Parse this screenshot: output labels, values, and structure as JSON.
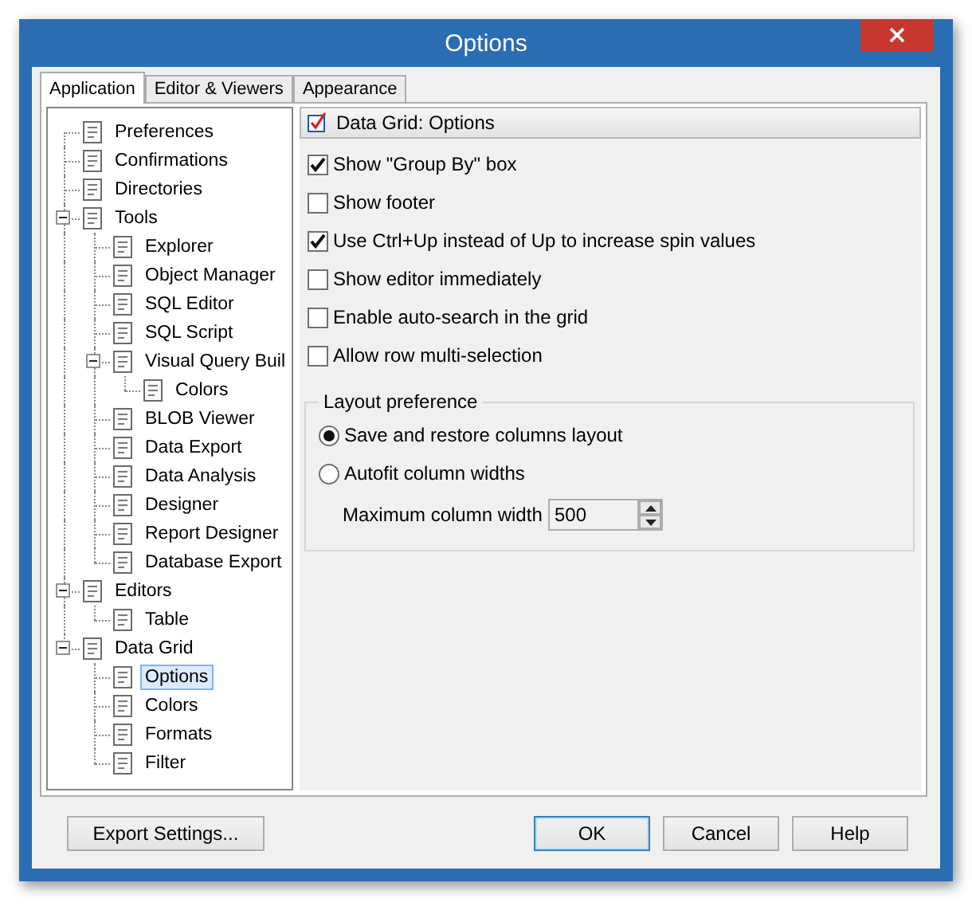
{
  "window": {
    "title": "Options"
  },
  "tabs": [
    {
      "label": "Application",
      "selected": true
    },
    {
      "label": "Editor & Viewers",
      "selected": false
    },
    {
      "label": "Appearance",
      "selected": false
    }
  ],
  "tree": [
    {
      "label": "Preferences",
      "selected": false
    },
    {
      "label": "Confirmations",
      "selected": false
    },
    {
      "label": "Directories",
      "selected": false
    },
    {
      "label": "Tools",
      "selected": false,
      "expanded": true,
      "children": [
        {
          "label": "Explorer",
          "selected": false
        },
        {
          "label": "Object Manager",
          "selected": false
        },
        {
          "label": "SQL Editor",
          "selected": false
        },
        {
          "label": "SQL Script",
          "selected": false
        },
        {
          "label": "Visual Query Buil",
          "selected": false,
          "expanded": true,
          "children": [
            {
              "label": "Colors",
              "selected": false
            }
          ]
        },
        {
          "label": "BLOB Viewer",
          "selected": false
        },
        {
          "label": "Data Export",
          "selected": false
        },
        {
          "label": "Data Analysis",
          "selected": false
        },
        {
          "label": "Designer",
          "selected": false
        },
        {
          "label": "Report Designer",
          "selected": false
        },
        {
          "label": "Database Export",
          "selected": false
        }
      ]
    },
    {
      "label": "Editors",
      "selected": false,
      "expanded": true,
      "children": [
        {
          "label": "Table",
          "selected": false
        }
      ]
    },
    {
      "label": "Data Grid",
      "selected": false,
      "expanded": true,
      "children": [
        {
          "label": "Options",
          "selected": true
        },
        {
          "label": "Colors",
          "selected": false
        },
        {
          "label": "Formats",
          "selected": false
        },
        {
          "label": "Filter",
          "selected": false
        }
      ]
    }
  ],
  "section_title": "Data Grid: Options",
  "options": [
    {
      "label": "Show \"Group By\" box",
      "checked": true
    },
    {
      "label": "Show footer",
      "checked": false
    },
    {
      "label": "Use Ctrl+Up instead of Up to increase spin values",
      "checked": true
    },
    {
      "label": "Show editor immediately",
      "checked": false
    },
    {
      "label": "Enable auto-search in the grid",
      "checked": false
    },
    {
      "label": "Allow row multi-selection",
      "checked": false
    }
  ],
  "layout_group": {
    "title": "Layout preference",
    "choices": [
      {
        "label": "Save and restore columns layout",
        "selected": true
      },
      {
        "label": "Autofit column widths",
        "selected": false
      }
    ],
    "max_width": {
      "label": "Maximum column width",
      "value": "500"
    }
  },
  "buttons": [
    {
      "label": "Export Settings...",
      "default": false
    },
    {
      "label": "OK",
      "default": true
    },
    {
      "label": "Cancel",
      "default": false
    },
    {
      "label": "Help",
      "default": false
    }
  ]
}
